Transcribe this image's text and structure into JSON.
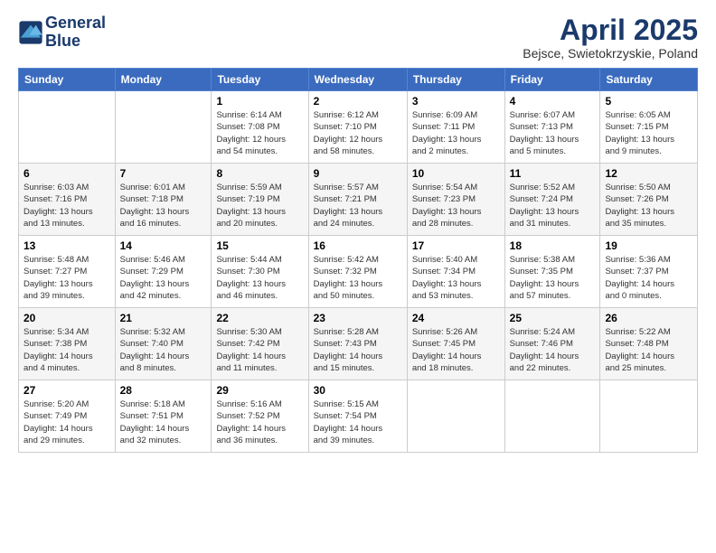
{
  "logo": {
    "line1": "General",
    "line2": "Blue"
  },
  "title": "April 2025",
  "location": "Bejsce, Swietokrzyskie, Poland",
  "days_of_week": [
    "Sunday",
    "Monday",
    "Tuesday",
    "Wednesday",
    "Thursday",
    "Friday",
    "Saturday"
  ],
  "weeks": [
    [
      {
        "day": "",
        "info": ""
      },
      {
        "day": "",
        "info": ""
      },
      {
        "day": "1",
        "info": "Sunrise: 6:14 AM\nSunset: 7:08 PM\nDaylight: 12 hours\nand 54 minutes."
      },
      {
        "day": "2",
        "info": "Sunrise: 6:12 AM\nSunset: 7:10 PM\nDaylight: 12 hours\nand 58 minutes."
      },
      {
        "day": "3",
        "info": "Sunrise: 6:09 AM\nSunset: 7:11 PM\nDaylight: 13 hours\nand 2 minutes."
      },
      {
        "day": "4",
        "info": "Sunrise: 6:07 AM\nSunset: 7:13 PM\nDaylight: 13 hours\nand 5 minutes."
      },
      {
        "day": "5",
        "info": "Sunrise: 6:05 AM\nSunset: 7:15 PM\nDaylight: 13 hours\nand 9 minutes."
      }
    ],
    [
      {
        "day": "6",
        "info": "Sunrise: 6:03 AM\nSunset: 7:16 PM\nDaylight: 13 hours\nand 13 minutes."
      },
      {
        "day": "7",
        "info": "Sunrise: 6:01 AM\nSunset: 7:18 PM\nDaylight: 13 hours\nand 16 minutes."
      },
      {
        "day": "8",
        "info": "Sunrise: 5:59 AM\nSunset: 7:19 PM\nDaylight: 13 hours\nand 20 minutes."
      },
      {
        "day": "9",
        "info": "Sunrise: 5:57 AM\nSunset: 7:21 PM\nDaylight: 13 hours\nand 24 minutes."
      },
      {
        "day": "10",
        "info": "Sunrise: 5:54 AM\nSunset: 7:23 PM\nDaylight: 13 hours\nand 28 minutes."
      },
      {
        "day": "11",
        "info": "Sunrise: 5:52 AM\nSunset: 7:24 PM\nDaylight: 13 hours\nand 31 minutes."
      },
      {
        "day": "12",
        "info": "Sunrise: 5:50 AM\nSunset: 7:26 PM\nDaylight: 13 hours\nand 35 minutes."
      }
    ],
    [
      {
        "day": "13",
        "info": "Sunrise: 5:48 AM\nSunset: 7:27 PM\nDaylight: 13 hours\nand 39 minutes."
      },
      {
        "day": "14",
        "info": "Sunrise: 5:46 AM\nSunset: 7:29 PM\nDaylight: 13 hours\nand 42 minutes."
      },
      {
        "day": "15",
        "info": "Sunrise: 5:44 AM\nSunset: 7:30 PM\nDaylight: 13 hours\nand 46 minutes."
      },
      {
        "day": "16",
        "info": "Sunrise: 5:42 AM\nSunset: 7:32 PM\nDaylight: 13 hours\nand 50 minutes."
      },
      {
        "day": "17",
        "info": "Sunrise: 5:40 AM\nSunset: 7:34 PM\nDaylight: 13 hours\nand 53 minutes."
      },
      {
        "day": "18",
        "info": "Sunrise: 5:38 AM\nSunset: 7:35 PM\nDaylight: 13 hours\nand 57 minutes."
      },
      {
        "day": "19",
        "info": "Sunrise: 5:36 AM\nSunset: 7:37 PM\nDaylight: 14 hours\nand 0 minutes."
      }
    ],
    [
      {
        "day": "20",
        "info": "Sunrise: 5:34 AM\nSunset: 7:38 PM\nDaylight: 14 hours\nand 4 minutes."
      },
      {
        "day": "21",
        "info": "Sunrise: 5:32 AM\nSunset: 7:40 PM\nDaylight: 14 hours\nand 8 minutes."
      },
      {
        "day": "22",
        "info": "Sunrise: 5:30 AM\nSunset: 7:42 PM\nDaylight: 14 hours\nand 11 minutes."
      },
      {
        "day": "23",
        "info": "Sunrise: 5:28 AM\nSunset: 7:43 PM\nDaylight: 14 hours\nand 15 minutes."
      },
      {
        "day": "24",
        "info": "Sunrise: 5:26 AM\nSunset: 7:45 PM\nDaylight: 14 hours\nand 18 minutes."
      },
      {
        "day": "25",
        "info": "Sunrise: 5:24 AM\nSunset: 7:46 PM\nDaylight: 14 hours\nand 22 minutes."
      },
      {
        "day": "26",
        "info": "Sunrise: 5:22 AM\nSunset: 7:48 PM\nDaylight: 14 hours\nand 25 minutes."
      }
    ],
    [
      {
        "day": "27",
        "info": "Sunrise: 5:20 AM\nSunset: 7:49 PM\nDaylight: 14 hours\nand 29 minutes."
      },
      {
        "day": "28",
        "info": "Sunrise: 5:18 AM\nSunset: 7:51 PM\nDaylight: 14 hours\nand 32 minutes."
      },
      {
        "day": "29",
        "info": "Sunrise: 5:16 AM\nSunset: 7:52 PM\nDaylight: 14 hours\nand 36 minutes."
      },
      {
        "day": "30",
        "info": "Sunrise: 5:15 AM\nSunset: 7:54 PM\nDaylight: 14 hours\nand 39 minutes."
      },
      {
        "day": "",
        "info": ""
      },
      {
        "day": "",
        "info": ""
      },
      {
        "day": "",
        "info": ""
      }
    ]
  ]
}
